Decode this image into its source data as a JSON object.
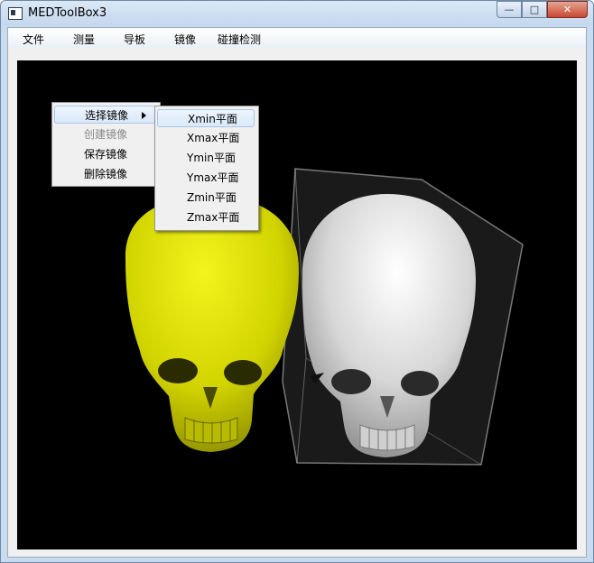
{
  "window": {
    "title": "MEDToolBox3",
    "min_glyph": "—",
    "max_glyph": "□",
    "close_glyph": "✕"
  },
  "menubar": {
    "items": [
      "文件",
      "测量",
      "导板",
      "镜像",
      "碰撞检测"
    ]
  },
  "context_menu": {
    "items": [
      {
        "label": "选择镜像",
        "has_submenu": true,
        "highlighted": true,
        "enabled": true
      },
      {
        "label": "创建镜像",
        "enabled": false
      },
      {
        "label": "保存镜像",
        "enabled": true
      },
      {
        "label": "删除镜像",
        "enabled": true
      }
    ]
  },
  "submenu": {
    "items": [
      "Xmin平面",
      "Xmax平面",
      "Ymin平面",
      "Ymax平面",
      "Zmin平面",
      "Zmax平面"
    ],
    "highlighted_index": 0
  },
  "scene": {
    "background": "#000000",
    "original_skull_color": "#e3e600",
    "mirror_skull_color": "#e4e4e4",
    "bounding_box_color": "#bfbfbf"
  }
}
